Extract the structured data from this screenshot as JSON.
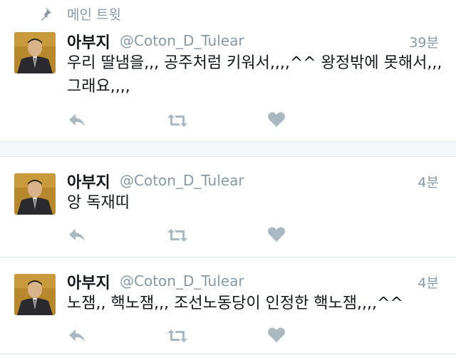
{
  "pinned": {
    "label": "메인 트윗"
  },
  "tweets": [
    {
      "name": "아부지",
      "handle": "@Coton_D_Tulear",
      "time": "39분",
      "text": "우리 딸냄을,,, 공주처럼 키워서,,,,^^ 왕정밖에 못해서,,, 그래요,,,,"
    },
    {
      "name": "아부지",
      "handle": "@Coton_D_Tulear",
      "time": "4분",
      "text": "앙 독재띠"
    },
    {
      "name": "아부지",
      "handle": "@Coton_D_Tulear",
      "time": "4분",
      "text": "노잼,, 핵노잼,,, 조선노동당이 인정한 핵노잼,,,,^^"
    }
  ],
  "icons": {
    "reply": "reply-icon",
    "retweet": "retweet-icon",
    "like": "heart-icon",
    "pin": "pin-icon"
  },
  "colors": {
    "meta_gray": "#8899a6",
    "icon_gray": "#aab8c2",
    "divider": "#e1e8ed",
    "band": "#f5f8fa"
  }
}
